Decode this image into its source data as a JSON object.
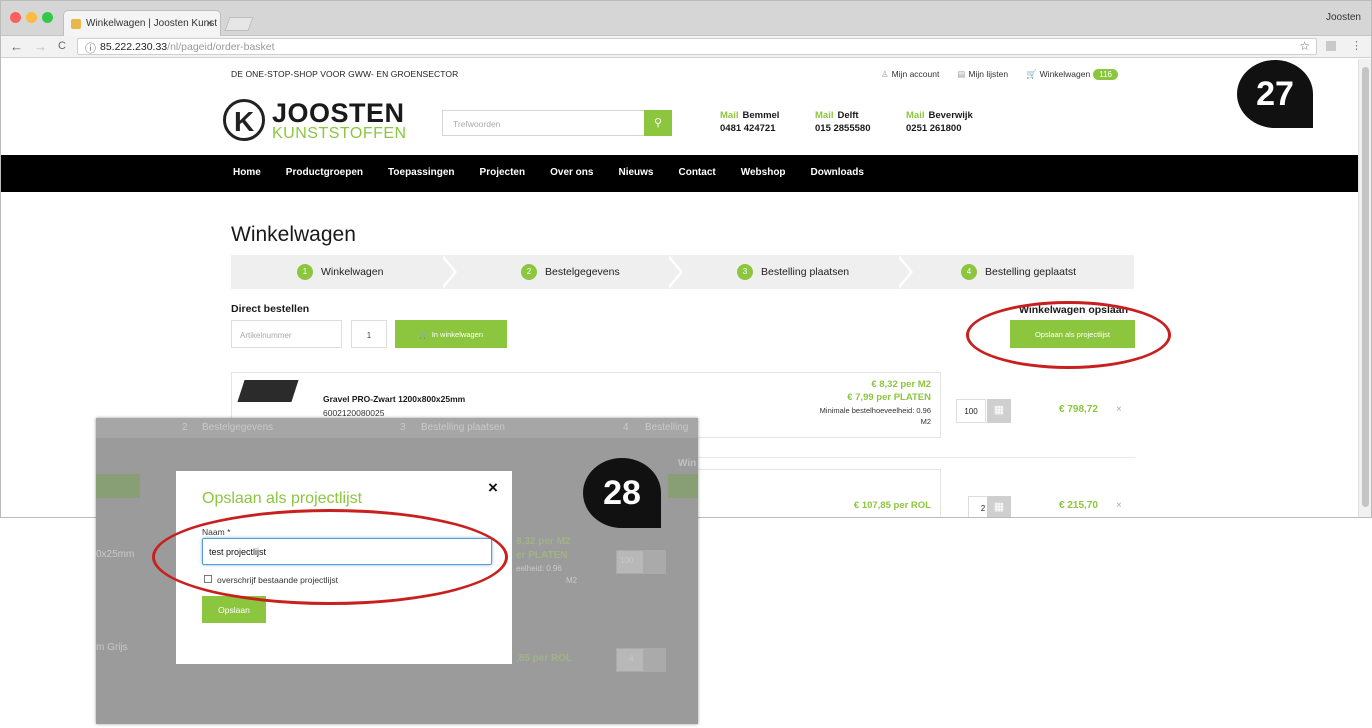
{
  "browser": {
    "tab_title": "Winkelwagen | Joosten Kunst",
    "tab_close": "×",
    "user": "Joosten",
    "url_host": "85.222.230.33",
    "url_path": "/nl/pageid/order-basket",
    "info_glyph": "ⓘ",
    "back_glyph": "←",
    "forward_glyph": "→",
    "reload_glyph": "C",
    "star_glyph": "☆",
    "traffic_colors": [
      "#fc605c",
      "#fdbc40",
      "#34c84a"
    ]
  },
  "header": {
    "tagline": "DE ONE-STOP-SHOP VOOR GWW- EN GROENSECTOR",
    "account": "Mijn account",
    "lists": "Mijn lijsten",
    "cart": "Winkelwagen",
    "cart_count": "116",
    "logo_mark": "K",
    "logo_name": "JOOSTEN",
    "logo_sub": "KUNSTSTOFFEN",
    "search_placeholder": "Trefwoorden",
    "search_icon": "⚲",
    "locations": [
      {
        "mail": "Mail",
        "name": "Bemmel",
        "phone": "0481 424721"
      },
      {
        "mail": "Mail",
        "name": "Delft",
        "phone": "015 2855580"
      },
      {
        "mail": "Mail",
        "name": "Beverwijk",
        "phone": "0251 261800"
      }
    ]
  },
  "nav": [
    "Home",
    "Productgroepen",
    "Toepassingen",
    "Projecten",
    "Over ons",
    "Nieuws",
    "Contact",
    "Webshop",
    "Downloads"
  ],
  "main": {
    "title": "Winkelwagen",
    "steps": [
      {
        "num": "1",
        "label": "Winkelwagen"
      },
      {
        "num": "2",
        "label": "Bestelgegevens"
      },
      {
        "num": "3",
        "label": "Bestelling plaatsen"
      },
      {
        "num": "4",
        "label": "Bestelling geplaatst"
      }
    ],
    "direct_title": "Direct bestellen",
    "article_placeholder": "Artikelnummer",
    "qty_default": "1",
    "add_button": "In winkelwagen",
    "add_icon": "🛒",
    "save_title": "Winkelwagen opslaan",
    "save_button": "Opslaan als projectlijst"
  },
  "products": [
    {
      "name": "Gravel PRO-Zwart 1200x800x25mm",
      "code": "6002120080025",
      "price_m2": "€ 8,32 per M2",
      "price_unit": "€ 7,99 per PLATEN",
      "min_order": "Minimale bestelhoeveelheid: 0.96",
      "min_unit": "M2",
      "qty": "100",
      "total": "€ 798,72",
      "remove": "×"
    },
    {
      "price_unit": "€ 107,85 per ROL",
      "qty": "2",
      "total": "€ 215,70",
      "remove": "×"
    }
  ],
  "calc_icon": "▦",
  "callouts": {
    "first": "27",
    "second": "28"
  },
  "modal_shot": {
    "bg_step2": "Bestelgegevens",
    "bg_step3": "Bestelling plaatsen",
    "bg_step4": "Bestelling",
    "bg_num2": "2",
    "bg_num3": "3",
    "bg_num4": "4",
    "bg_win": "Win",
    "bg_frag1": "0x25mm",
    "bg_frag2": "m Grijs",
    "bg_price1": "8,32 per M2",
    "bg_price2": "er PLATEN",
    "bg_price3": "eelheid: 0.96",
    "bg_price4": "M2",
    "bg_qty1": "100",
    "bg_price5": ",85 per ROL",
    "bg_qty2": "4",
    "modal": {
      "title": "Opslaan als projectlijst",
      "close": "×",
      "label": "Naam",
      "required": "*",
      "value": "test projectlijst",
      "checkbox_label": "overschrijf bestaande projectlijst",
      "save": "Opslaan"
    }
  },
  "colors": {
    "accent": "#8cc63f",
    "highlight": "#c8201e",
    "nav_bg": "#000000"
  }
}
